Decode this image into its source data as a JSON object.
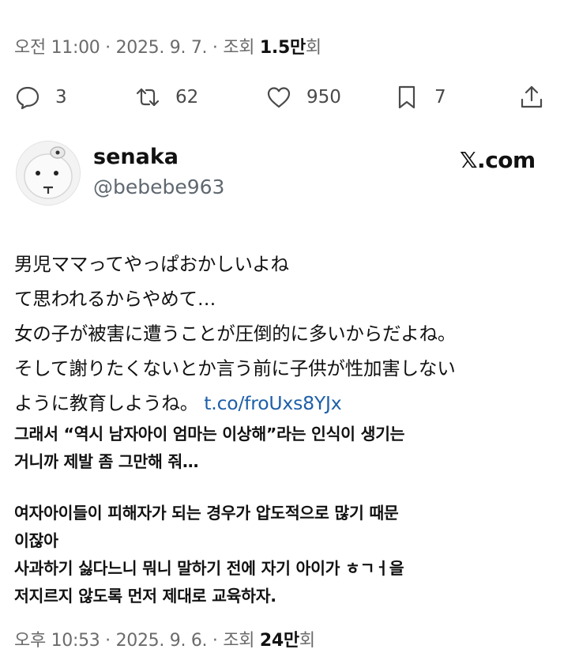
{
  "top_meta": {
    "time": "오전 11:00",
    "sep1": " · ",
    "date": "2025. 9. 7.",
    "sep2": " · ",
    "views_label": "조회 ",
    "views_count": "1.5만",
    "views_suffix": "회"
  },
  "actions": {
    "reply_count": "3",
    "repost_count": "62",
    "like_count": "950",
    "bookmark_count": "7"
  },
  "quoted": {
    "display_name": "senaka",
    "handle": "@bebebe963",
    "source": "𝕏.com",
    "lines": [
      "男児ママってやっぱおかしいよね",
      "て思われるからやめて…",
      "女の子が被害に遭うことが圧倒的に多いからだよね。",
      "そして謝りたくないとか言う前に子供が性加害しない",
      "ように教育しようね。"
    ],
    "link_text": "t.co/froUxs8YJx"
  },
  "translation": {
    "para1": [
      "그래서 “역시 남자아이 엄마는 이상해”라는 인식이 생기는",
      "거니까 제발 좀 그만해 줘…"
    ],
    "para2": [
      "여자아이들이 피해자가 되는 경우가 압도적으로 많기 때문",
      "이잖아",
      "사과하기 싫다느니 뭐니 말하기 전에 자기 아이가 ㅎㄱㅓ을",
      "저지르지 않도록 먼저 제대로 교육하자."
    ]
  },
  "bottom_meta": {
    "time": "오후 10:53",
    "sep1": " · ",
    "date": "2025. 9. 6.",
    "sep2": " · ",
    "views_label": "조회 ",
    "views_count": "24만",
    "views_suffix": "회"
  },
  "icons": {
    "reply": "reply-bubble-icon",
    "repost": "repost-arrows-icon",
    "like": "heart-icon",
    "bookmark": "bookmark-icon",
    "share": "share-upload-icon"
  }
}
